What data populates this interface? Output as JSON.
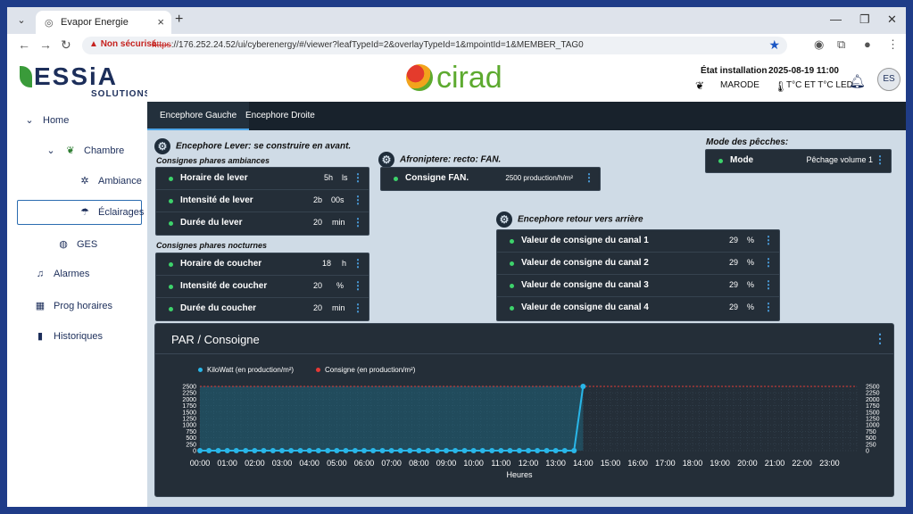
{
  "browser": {
    "tab_title": "Evapor Energie",
    "insecure_label": "Non sécurisé",
    "url_scheme": "https",
    "url_rest": "://176.252.24.52/ui/cyberenergy/#/viewer?leafTypeId=2&overlayTypeId=1&mpointId=1&MEMBER_TAG0"
  },
  "logo": {
    "word": "ESSiA",
    "sub": "SOLUTIONS"
  },
  "sidebar": {
    "items": [
      {
        "label": "Home",
        "icon": "chevron-down"
      },
      {
        "label": "Chambre",
        "icon": "leaf"
      },
      {
        "label": "Ambiance",
        "icon": "fan"
      },
      {
        "label": "Éclairages",
        "icon": "lamp"
      },
      {
        "label": "GES",
        "icon": "globe"
      },
      {
        "label": "Alarmes",
        "icon": "bell"
      },
      {
        "label": "Prog horaires",
        "icon": "calendar"
      },
      {
        "label": "Historiques",
        "icon": "bar-chart"
      }
    ]
  },
  "header": {
    "brand": "cirad",
    "status_title": "État installation",
    "site": "MARODE",
    "datetime": "2025-08-19 11:00",
    "temps": "T°C ET T°C LED",
    "avatar": "ES"
  },
  "tabs": [
    {
      "label": "Encephore Gauche",
      "active": true
    },
    {
      "label": "Encephore Droite",
      "active": false
    }
  ],
  "lever": {
    "title": "Encephore Lever: se construire en avant.",
    "sub_ambiance": "Consignes phares ambiances",
    "rows": [
      {
        "label": "Horaire de lever",
        "value": "5h",
        "unit": "ls"
      },
      {
        "label": "Intensité de lever",
        "value": "2b",
        "unit": "00s"
      },
      {
        "label": "Durée du lever",
        "value": "20",
        "unit": "min"
      }
    ],
    "sub_nocturne": "Consignes phares nocturnes",
    "rows_night": [
      {
        "label": "Horaire de coucher",
        "value": "18",
        "unit": "h"
      },
      {
        "label": "Intensité de coucher",
        "value": "20",
        "unit": "%"
      },
      {
        "label": "Durée du coucher",
        "value": "20",
        "unit": "min"
      }
    ]
  },
  "fan": {
    "title": "Afroniptere: recto: FAN.",
    "row": {
      "label": "Consigne FAN.",
      "value": "2500 production/h/m²"
    }
  },
  "peche": {
    "title": "Mode des pêcches:",
    "row": {
      "label": "Mode",
      "value": "Pêchage volume 1"
    }
  },
  "retour": {
    "title": "Encephore retour vers arrière",
    "rows": [
      {
        "label": "Valeur de consigne du canal 1",
        "value": "29",
        "unit": "%"
      },
      {
        "label": "Valeur de consigne du canal 2",
        "value": "29",
        "unit": "%"
      },
      {
        "label": "Valeur de consigne du canal 3",
        "value": "29",
        "unit": "%"
      },
      {
        "label": "Valeur de consigne du canal 4",
        "value": "29",
        "unit": "%"
      }
    ]
  },
  "chart_title": "PAR / Consoigne",
  "chart_data": {
    "type": "line",
    "xlabel": "Heures",
    "ylabel": "",
    "ylim": [
      0,
      2500
    ],
    "yticks": [
      0,
      250,
      500,
      750,
      1000,
      1250,
      1500,
      1750,
      2000,
      2250,
      2500
    ],
    "categories": [
      "00:00",
      "01:00",
      "02:00",
      "03:00",
      "04:00",
      "05:00",
      "06:00",
      "07:00",
      "08:00",
      "09:00",
      "10:00",
      "11:00",
      "12:00",
      "13:00",
      "14:00",
      "15:00",
      "16:00",
      "17:00",
      "18:00",
      "19:00",
      "20:00",
      "21:00",
      "22:00",
      "23:00"
    ],
    "series": [
      {
        "name": "KiloWatt (en production/m²)",
        "color": "#29b6e8",
        "x": [
          0,
          0.33,
          0.67,
          1,
          1.33,
          1.67,
          2,
          2.33,
          2.67,
          3,
          3.33,
          3.67,
          4,
          4.33,
          4.67,
          5,
          5.33,
          5.67,
          6,
          6.33,
          6.67,
          7,
          7.33,
          7.67,
          8,
          8.33,
          8.67,
          9,
          9.33,
          9.67,
          10,
          10.33,
          10.67,
          11,
          11.33,
          11.67,
          12,
          12.33,
          12.67,
          13,
          13.33,
          13.67,
          14
        ],
        "y": [
          0,
          0,
          0,
          0,
          0,
          0,
          0,
          0,
          0,
          0,
          0,
          0,
          0,
          0,
          0,
          0,
          0,
          0,
          0,
          0,
          0,
          0,
          0,
          0,
          0,
          0,
          0,
          0,
          0,
          0,
          0,
          0,
          0,
          0,
          0,
          0,
          0,
          0,
          0,
          0,
          0,
          0,
          2500
        ]
      },
      {
        "name": "Consigne (en production/m²)",
        "color": "#e53935",
        "x": [
          0,
          24
        ],
        "y": [
          2500,
          2500
        ]
      }
    ]
  }
}
